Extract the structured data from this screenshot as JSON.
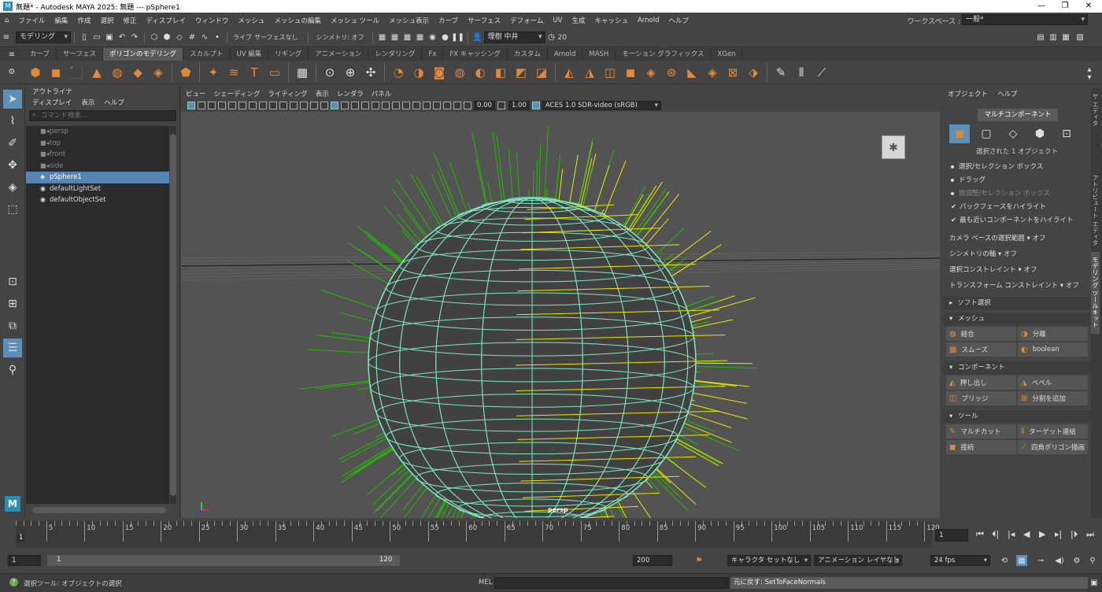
{
  "window": {
    "title": "無題* - Autodesk MAYA 2025: 無題   ---   pSphere1",
    "app_icon": "M"
  },
  "menu": [
    "ファイル",
    "編集",
    "作成",
    "選択",
    "修正",
    "ディスプレイ",
    "ウィンドウ",
    "メッシュ",
    "メッシュの編集",
    "メッシュ ツール",
    "メッシュ表示",
    "カーブ",
    "サーフェス",
    "デフォーム",
    "UV",
    "生成",
    "キャッシュ",
    "Arnold",
    "ヘルプ"
  ],
  "workspace": {
    "label": "ワークスペース :",
    "value": "一般*"
  },
  "status": {
    "mode": "モデリング",
    "live": "ライブ",
    "surface": "サーフェスなし",
    "symmetry": "シンメトリ: オフ",
    "user": "理樹 中井",
    "count": "20"
  },
  "shelf_tabs": [
    "カーブ",
    "サーフェス",
    "ポリゴンのモデリング",
    "スカルプト",
    "UV 編集",
    "リギング",
    "アニメーション",
    "レンダリング",
    "Fx",
    "FX キャッシング",
    "カスタム",
    "Arnold",
    "MASH",
    "モーション グラフィックス",
    "XGen"
  ],
  "shelf_active": "ポリゴンのモデリング",
  "outliner": {
    "title": "アウトライナ",
    "menu": [
      "ディスプレイ",
      "表示",
      "ヘルプ"
    ],
    "search_placeholder": "コマンド検索...",
    "items": [
      {
        "label": "persp",
        "dim": true
      },
      {
        "label": "top",
        "dim": true
      },
      {
        "label": "front",
        "dim": true
      },
      {
        "label": "side",
        "dim": true
      },
      {
        "label": "pSphere1",
        "selected": true
      },
      {
        "label": "defaultLightSet"
      },
      {
        "label": "defaultObjectSet"
      }
    ]
  },
  "viewport": {
    "menu": [
      "ビュー",
      "シェーディング",
      "ライティング",
      "表示",
      "レンダラ",
      "パネル"
    ],
    "val1": "0.00",
    "val2": "1.00",
    "colorspace": "ACES 1.0 SDR-video (sRGB)",
    "camera": "persp"
  },
  "attr": {
    "menu": [
      "オブジェクト",
      "ヘルプ"
    ],
    "title": "マルチコンポーネント",
    "selected": "選択された 1 オブジェクト",
    "radio": [
      {
        "label": "選択/セレクション ボックス",
        "dim": false
      },
      {
        "label": "ドラッグ",
        "dim": false
      },
      {
        "label": "微調整/セレクション ボックス",
        "dim": true
      }
    ],
    "checks": [
      "バックフェースをハイライト",
      "最も近いコンポーネントをハイライト"
    ],
    "opts": [
      {
        "label": "カメラ ベースの選択範囲",
        "val": "オフ"
      },
      {
        "label": "シンメトリの軸",
        "val": "オフ"
      },
      {
        "label": "選択コンストレイント",
        "val": "オフ"
      },
      {
        "label": "トランスフォーム コンストレイント",
        "val": "オフ"
      }
    ],
    "soft": "ソフト選択",
    "sections": [
      {
        "title": "メッシュ",
        "buttons": [
          "結合",
          "分離",
          "スムーズ",
          "boolean"
        ]
      },
      {
        "title": "コンポーネント",
        "buttons": [
          "押し出し",
          "ベベル",
          "ブリッジ",
          "分割を追加"
        ]
      },
      {
        "title": "ツール",
        "buttons": [
          "マルチカット",
          "ターゲット連結",
          "接続",
          "四角ポリゴン描画"
        ]
      }
    ]
  },
  "side_tabs": [
    "チャネル ボックス/レイヤ エディタ",
    "アトリビュート エディタ",
    "モデリング ツールキット"
  ],
  "timeline": {
    "labels": [
      "5",
      "10",
      "15",
      "20",
      "25",
      "30",
      "35",
      "40",
      "45",
      "50",
      "55",
      "60",
      "65",
      "70",
      "75",
      "80",
      "85",
      "90",
      "95",
      "100",
      "105",
      "110",
      "115",
      "120"
    ],
    "current": "1",
    "frame": "1"
  },
  "range": {
    "start": "1",
    "inner_start": "1",
    "inner_end": "120",
    "end": "200",
    "character": "キャラクタ セットなし",
    "anim_layer": "アニメーション レイヤなし",
    "fps": "24 fps"
  },
  "statusbar": {
    "help": "選択ツール: オブジェクトの選択",
    "mel": "MEL",
    "result": "元に戻す: SetToFaceNormals"
  },
  "colors": {
    "accent": "#5c8fb8",
    "icon_orange": "#e08a3a",
    "wire": "#7fe6c0",
    "normals_green": "#22bb00",
    "normals_yellow": "#e8e800"
  }
}
